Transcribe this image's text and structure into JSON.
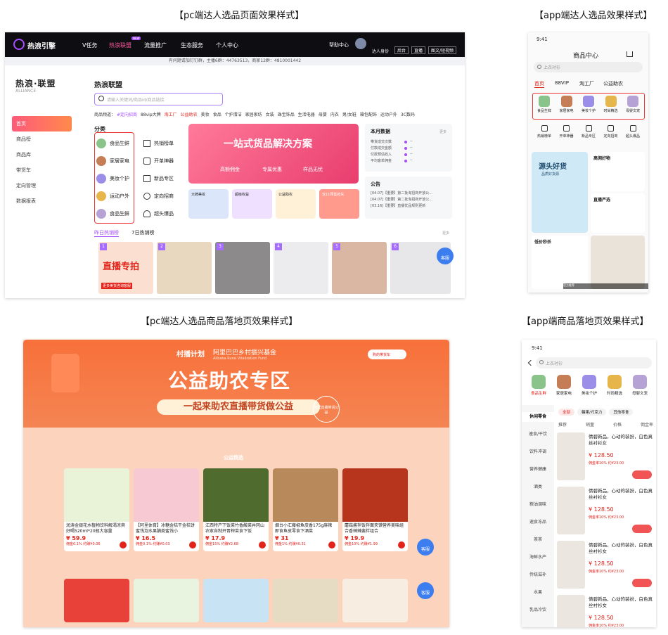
{
  "captions": {
    "pc_sel": "【pc端达人选品页面效果样式】",
    "app_sel": "【app端达人选品效果样式】",
    "pc_land": "【pc端达人选品商品落地页效果样式】",
    "app_land": "【app端商品落地页效果样式】"
  },
  "pc": {
    "logo": "热浪引擎",
    "nav": [
      "V任务",
      "热浪联盟",
      "流量推广",
      "生态服务",
      "个人中心"
    ],
    "nav_badge": "NEW",
    "help": "帮助中心",
    "role_label": "达人身份",
    "role_tabs": [
      "后台",
      "直播",
      "图文/短视频"
    ],
    "notice": "有问题请加钉钉群，主播6群：44763513，商家12群：4810001442",
    "brand": "热浪·联盟",
    "brand_sub": "ALLIANCE",
    "section_title": "热浪联盟",
    "search_placeholder": "请输入关键词/商品id/商品链接",
    "sidebar": [
      "首页",
      "商品榜",
      "商品库",
      "带货车",
      "定向管理",
      "数据报表"
    ],
    "channel_label": "商品频道：",
    "channels": [
      "#定向招商",
      "88vip大牌",
      "淘工厂",
      "公益助农",
      "美妆",
      "食品",
      "个护清洁",
      "家居家纺",
      "女装",
      "珠宝饰品",
      "生活电器",
      "母婴",
      "内衣",
      "男/女鞋",
      "箱包配饰",
      "运动户外",
      "3C数码"
    ],
    "category_title": "分类",
    "categories": [
      "食品生鲜",
      "家居家电",
      "美妆个护",
      "运动户外",
      "食品生鲜"
    ],
    "hot": [
      "热销榜单",
      "开单神器",
      "新品专区",
      "定向招商",
      "超头爆品"
    ],
    "banner": {
      "title": "一站式货品解决方案",
      "tags": [
        "高额佣金",
        "专属优惠",
        "样品无忧"
      ]
    },
    "promos": [
      "大牌美妆",
      "超级权益",
      "公益助农",
      "双11预售抢先"
    ],
    "month_data": {
      "title": "本月数据",
      "more": "更多",
      "rows": [
        "带货成交次数",
        "付款成交金额",
        "付款预估收入",
        "平均客单佣金"
      ],
      "value": "--"
    },
    "announce": {
      "title": "公告",
      "rows": [
        "[04.07]【重要】第二批淘招商开放公...",
        "[04.07]【重要】第二批淘招商开放公...",
        "[03.16]【重要】直播优品规则更新"
      ]
    },
    "tabs": [
      "昨日热销榜",
      "7日热销榜"
    ],
    "tabs_more": "更多",
    "thumb_nums": [
      "1",
      "2",
      "3",
      "4",
      "5",
      "6"
    ],
    "thumb1_text": "直播专拍",
    "thumb1_sub": "更多美货咨询客服",
    "kefu": "客服"
  },
  "app": {
    "time": "9:41",
    "title": "商品中心",
    "search": "上衣衬衫",
    "tabs": [
      "首页",
      "88VIP",
      "淘工厂",
      "公益助农"
    ],
    "cats": [
      "食品生鲜",
      "家居家电",
      "美妆个护",
      "时尚精选",
      "母婴文宠"
    ],
    "tools": [
      "热销榜单",
      "开单神器",
      "新品专区",
      "定向招商",
      "超头爆品"
    ],
    "promo1": "源头好货",
    "promo1_sub": "品质好货源",
    "promo_a": "高佣好物",
    "promo_b": "直播严选",
    "promo_c": "低价秒杀",
    "tip": "官方推荐"
  },
  "land": {
    "brand": "村播计划",
    "brand_cn": "阿里巴巴乡村振兴基金",
    "brand_en": "Alibaba Rural Vitalization Fund",
    "title": "公益助农专区",
    "subtitle": "一起来助农直播带货做公益",
    "btn": "购的带货车",
    "stamp": "阿里直播带货公益",
    "section": "公益精选",
    "products": [
      {
        "title": "润涛金银花水植物饮料解渴凉爽好喝520ml*20瓶大容量",
        "price": "¥ 59.9",
        "meta": "佣金0.1%  约赚¥0.06"
      },
      {
        "title": "【阿里体育】冰糖金桔干金桔饼蜜饯泡水果脯类蜜饯小",
        "price": "¥ 16.5",
        "meta": "佣金0.1%  约赚¥0.03"
      },
      {
        "title": "江西特产下饭菜竹香酸菜井冈山农家自制开胃榨菜食下饭",
        "price": "¥ 17.9",
        "meta": "佣金15%  约赚¥2.68"
      },
      {
        "title": "烟台小汇藤椒鱼皮香175g麻辣即食鱼皮零食下酒菜",
        "price": "¥ 31",
        "meta": "佣金1%  约赚¥0.31"
      },
      {
        "title": "蘑菇酱拌饭拌面夹馍营养美味组合香辣辣酱拌组合",
        "price": "¥ 19.9",
        "meta": "佣金10%  约赚¥1.99"
      }
    ],
    "kefu": "客服"
  },
  "app_land": {
    "time": "9:41",
    "search": "上衣衬衫",
    "cats": [
      "食品生鲜",
      "家居家电",
      "美妆个护",
      "时尚精选",
      "母婴文宠"
    ],
    "left": [
      "休闲零食",
      "速食/干饮",
      "饮料冲调",
      "营养健康",
      "酒类",
      "粮油调味",
      "速食冻品",
      "茶茶",
      "海鲜水产",
      "传统滋补",
      "水果",
      "乳品冷饮"
    ],
    "filters": [
      "全部",
      "糖果/巧克力",
      "其他零食"
    ],
    "sorts": [
      "推荐",
      "销量",
      "价格",
      "佣金率"
    ],
    "product": {
      "title": "倩碧新品，心动的装扮，白色真丝衬衫女",
      "price": "¥ 128.50",
      "old": "¥ 118",
      "comm": "佣金率10%  约¥23.00"
    }
  }
}
